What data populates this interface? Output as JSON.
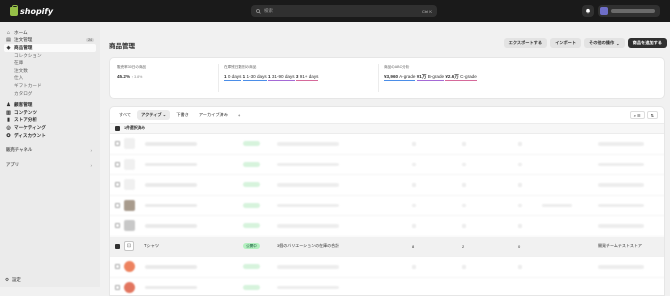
{
  "topbar": {
    "brand": "shopify",
    "search_placeholder": "検索",
    "search_shortcut": "Ctrl K",
    "notification_icon": "bell-icon"
  },
  "sidebar": {
    "items": [
      {
        "label": "ホーム",
        "icon": "home-icon"
      },
      {
        "label": "注文管理",
        "icon": "inbox-icon",
        "badge": "24"
      },
      {
        "label": "商品管理",
        "icon": "tag-icon",
        "active": true
      },
      {
        "label": "コレクション",
        "sub": true
      },
      {
        "label": "在庫",
        "sub": true
      },
      {
        "label": "注文数",
        "sub": true
      },
      {
        "label": "仕入",
        "sub": true
      },
      {
        "label": "ギフトカード",
        "sub": true
      },
      {
        "label": "カタログ",
        "sub": true
      },
      {
        "label": "顧客管理",
        "icon": "person-icon"
      },
      {
        "label": "コンテンツ",
        "icon": "document-icon"
      },
      {
        "label": "ストア分析",
        "icon": "chart-icon"
      },
      {
        "label": "マーケティング",
        "icon": "target-icon"
      },
      {
        "label": "ディスカウント",
        "icon": "discount-icon"
      }
    ],
    "sales_channels_label": "販売チャネル",
    "apps_label": "アプリ",
    "settings_label": "設定"
  },
  "page": {
    "title": "商品管理",
    "actions": {
      "export": "エクスポートする",
      "import": "インポート",
      "more": "その他の操作",
      "add": "商品を追加する"
    }
  },
  "stats": {
    "sell_through": {
      "label": "販売率30日の商品",
      "value": "45.2%",
      "delta": "↑ 3.8%"
    },
    "days_inventory": {
      "label": "在庫残日数別の商品",
      "buckets": [
        {
          "count": "1",
          "range": "0 days"
        },
        {
          "count": "1",
          "range": "1-30 days"
        },
        {
          "count": "1",
          "range": "31-90 days"
        },
        {
          "count": "3",
          "range": "91+ days"
        }
      ]
    },
    "abc": {
      "label": "商品のABC分析",
      "grades": [
        {
          "value": "¥3,960",
          "grade": "A-grade"
        },
        {
          "value": "¥1万",
          "grade": "B-grade"
        },
        {
          "value": "¥2.6万",
          "grade": "C-grade"
        }
      ]
    }
  },
  "table": {
    "tabs": [
      "すべて",
      "アクティブ",
      "下書き",
      "アーカイブ済み",
      "+"
    ],
    "active_tab": "アクティブ",
    "selected_text": "1件選択済み",
    "highlighted_row": {
      "title": "Tシャツ",
      "status": "公開中",
      "inventory": "3個のバリエーションの在庫の合計",
      "col1": "8",
      "col2": "2",
      "col3": "0",
      "vendor": "開発チームテストストア"
    }
  },
  "colors": {
    "topbar": "#1a1a1a",
    "brand_green": "#95bf47",
    "status_active_bg": "#b4f0c0",
    "status_active_text": "#0c5132"
  }
}
